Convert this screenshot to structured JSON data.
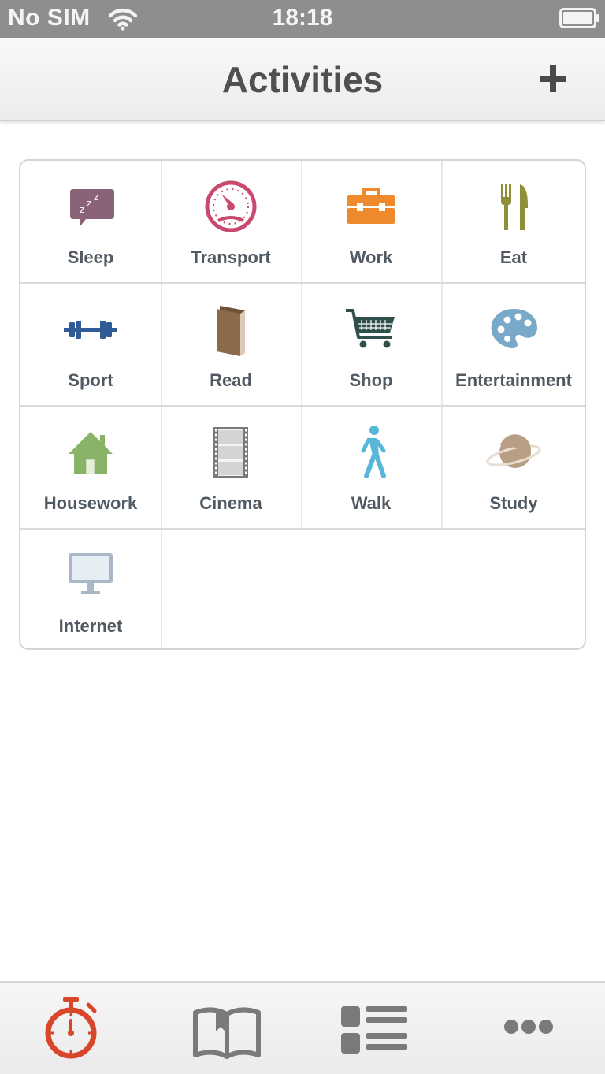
{
  "status_bar": {
    "carrier": "No SIM",
    "time": "18:18",
    "wifi_icon": "wifi-icon",
    "battery_icon": "battery-icon"
  },
  "header": {
    "title": "Activities",
    "add_icon": "plus-icon"
  },
  "activities": [
    {
      "label": "Sleep",
      "icon": "sleep-icon",
      "color": "#8b6378"
    },
    {
      "label": "Transport",
      "icon": "speedometer-icon",
      "color": "#c94a6f"
    },
    {
      "label": "Work",
      "icon": "toolbox-icon",
      "color": "#ef8a2c"
    },
    {
      "label": "Eat",
      "icon": "fork-knife-icon",
      "color": "#8f8f3a"
    },
    {
      "label": "Sport",
      "icon": "dumbbell-icon",
      "color": "#2f5b96"
    },
    {
      "label": "Read",
      "icon": "book-icon",
      "color": "#8a6a4a"
    },
    {
      "label": "Shop",
      "icon": "cart-icon",
      "color": "#2f4f4a"
    },
    {
      "label": "Entertainment",
      "icon": "palette-icon",
      "color": "#79a8c8"
    },
    {
      "label": "Housework",
      "icon": "house-icon",
      "color": "#8ab36a"
    },
    {
      "label": "Cinema",
      "icon": "film-icon",
      "color": "#8a8a8a"
    },
    {
      "label": "Walk",
      "icon": "walker-icon",
      "color": "#58b7d8"
    },
    {
      "label": "Study",
      "icon": "planet-icon",
      "color": "#b89e84"
    },
    {
      "label": "Internet",
      "icon": "monitor-icon",
      "color": "#a9b8c8"
    }
  ],
  "tab_bar": {
    "tabs": [
      {
        "icon": "stopwatch-icon",
        "active": true,
        "color": "#d9472b"
      },
      {
        "icon": "open-book-icon",
        "active": false,
        "color": "#7a7a7a"
      },
      {
        "icon": "list-icon",
        "active": false,
        "color": "#7a7a7a"
      },
      {
        "icon": "more-icon",
        "active": false,
        "color": "#7a7a7a"
      }
    ]
  }
}
